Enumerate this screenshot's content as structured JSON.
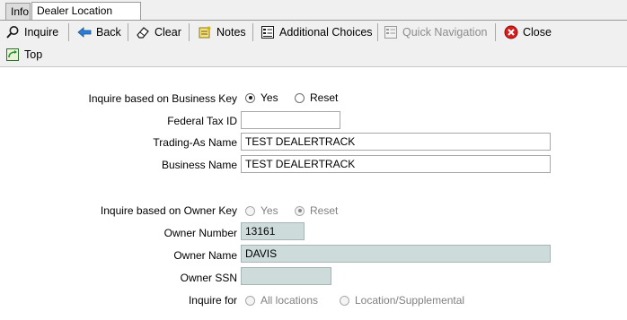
{
  "tabs": [
    {
      "label": "Info"
    },
    {
      "label": "Dealer Location Detail"
    }
  ],
  "toolbar": {
    "inquire": "Inquire",
    "back": "Back",
    "clear": "Clear",
    "notes": "Notes",
    "additional_choices": "Additional Choices",
    "quick_navigation": "Quick Navigation",
    "close": "Close",
    "top": "Top"
  },
  "business_key": {
    "label": "Inquire based on Business Key",
    "options": [
      "Yes",
      "Reset"
    ],
    "selected": "Yes"
  },
  "federal_tax_id": {
    "label": "Federal Tax ID",
    "value": ""
  },
  "trading_as_name": {
    "label": "Trading-As Name",
    "value": "TEST DEALERTRACK"
  },
  "business_name": {
    "label": "Business Name",
    "value": "TEST DEALERTRACK"
  },
  "owner_key": {
    "label": "Inquire based on Owner Key",
    "options": [
      "Yes",
      "Reset"
    ],
    "selected": "Reset"
  },
  "owner_number": {
    "label": "Owner Number",
    "value": "13161"
  },
  "owner_name": {
    "label": "Owner Name",
    "value": "DAVIS"
  },
  "owner_ssn": {
    "label": "Owner SSN",
    "value": ""
  },
  "inquire_for": {
    "label": "Inquire for",
    "options": [
      "All locations",
      "Location/Supplemental"
    ],
    "selected": ""
  },
  "colors": {
    "readonly_field": "#cddbdb",
    "toolbar_bg": "#f0f0f0"
  }
}
